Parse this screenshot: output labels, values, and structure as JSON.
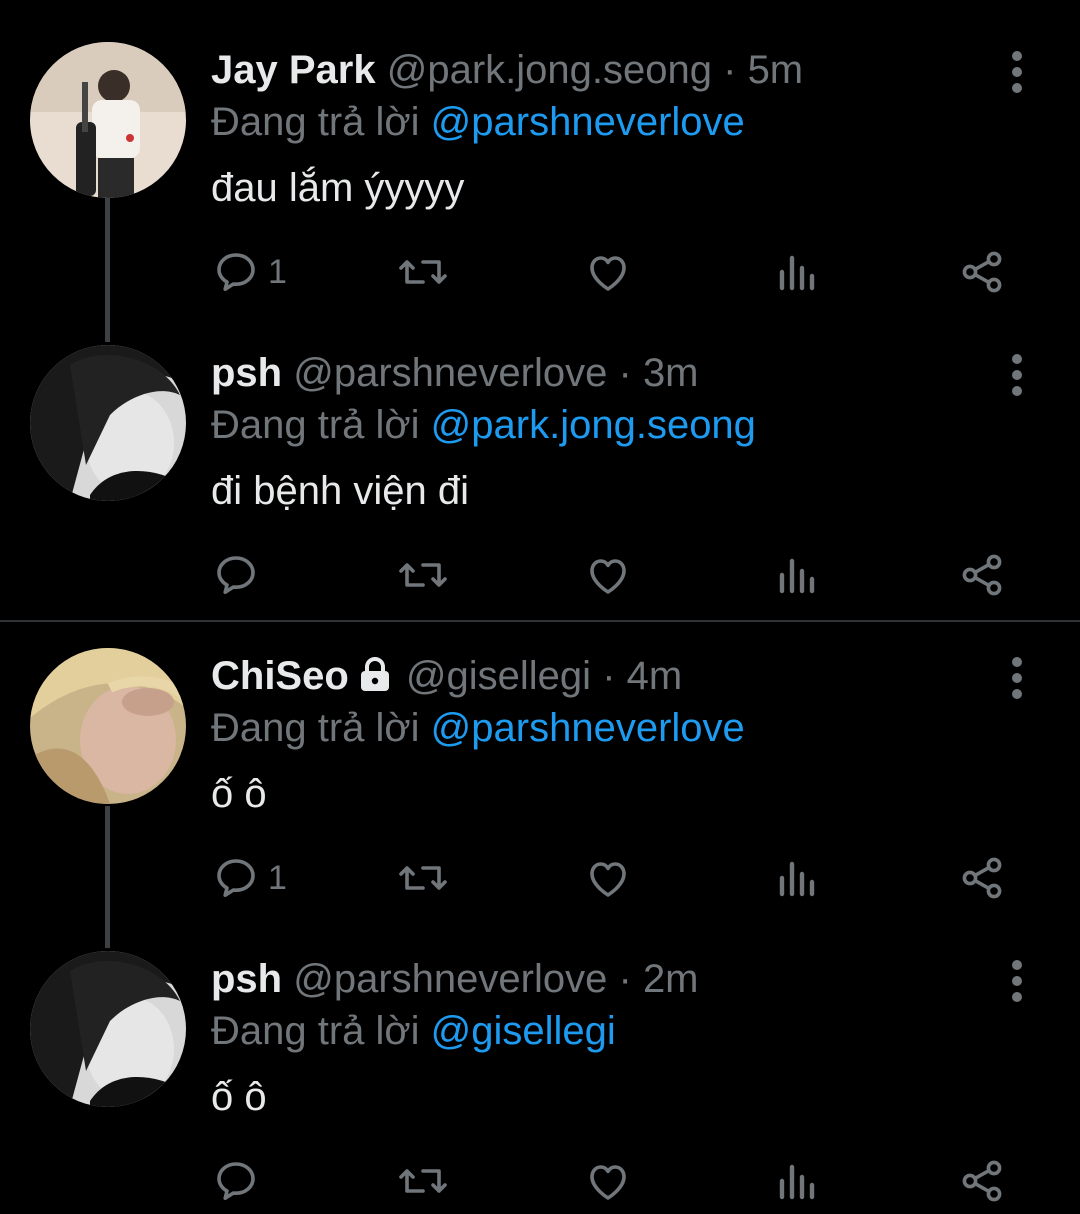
{
  "tweets": [
    {
      "name": "Jay Park",
      "handle": "@park.jong.seong",
      "separator": "·",
      "time": "5m",
      "reply_prefix": "Đang trả lời",
      "reply_to": "@parshneverlove",
      "text": "đau lắm ýyyyy",
      "reply_count": "1",
      "locked": false
    },
    {
      "name": "psh",
      "handle": "@parshneverlove",
      "separator": "·",
      "time": "3m",
      "reply_prefix": "Đang trả lời",
      "reply_to": "@park.jong.seong",
      "text": "đi bệnh viện đi",
      "reply_count": "",
      "locked": false
    },
    {
      "name": "ChiSeo",
      "handle": "@gisellegi",
      "separator": "·",
      "time": "4m",
      "reply_prefix": "Đang trả lời",
      "reply_to": "@parshneverlove",
      "text": "ố ô",
      "reply_count": "1",
      "locked": true
    },
    {
      "name": "psh",
      "handle": "@parshneverlove",
      "separator": "·",
      "time": "2m",
      "reply_prefix": "Đang trả lời",
      "reply_to": "@gisellegi",
      "text": "ố ô",
      "reply_count": "",
      "locked": false
    }
  ],
  "icons": {
    "reply": "reply-icon",
    "retweet": "retweet-icon",
    "like": "heart-icon",
    "views": "analytics-icon",
    "share": "share-icon",
    "more": "more-vertical-icon",
    "lock": "lock-icon"
  },
  "colors": {
    "background": "#000000",
    "text": "#e7e9ea",
    "secondary": "#71767b",
    "accent": "#1d9bf0",
    "thread_line": "#3e4144"
  }
}
